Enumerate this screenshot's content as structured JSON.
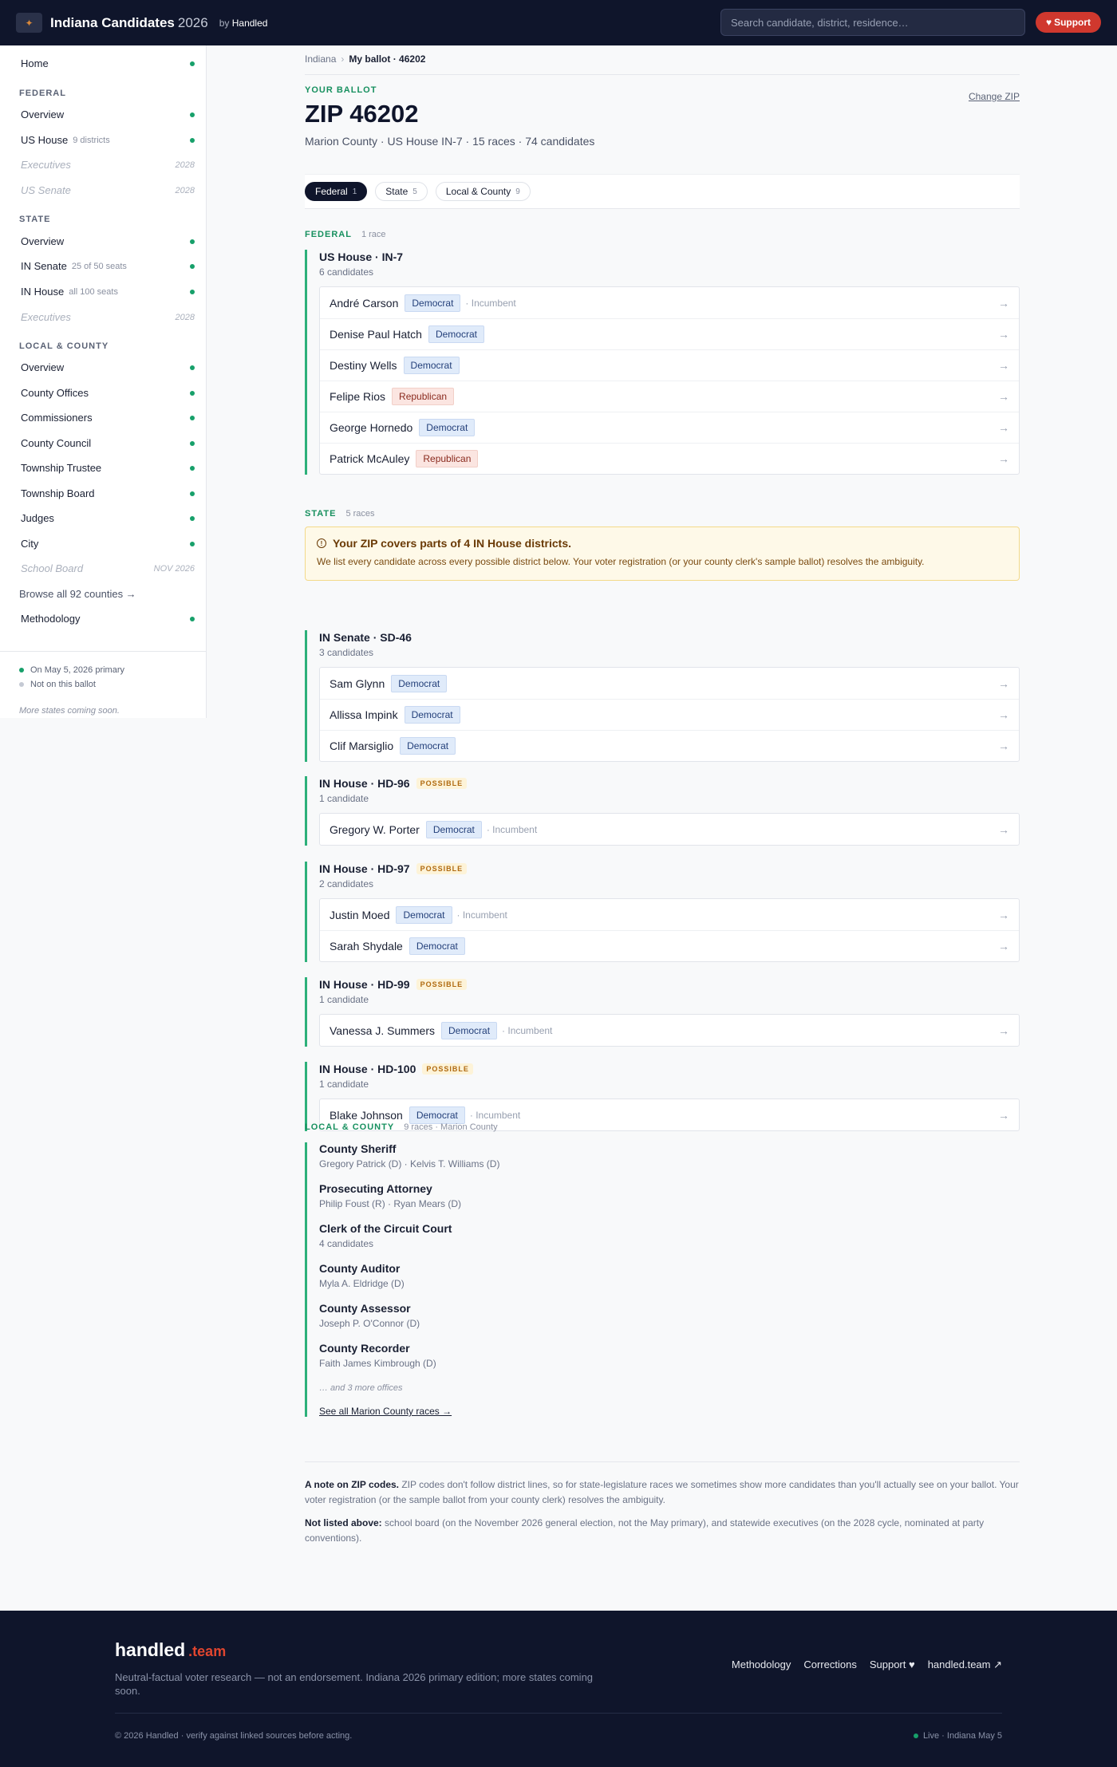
{
  "header": {
    "brand": "Indiana Candidates",
    "year": "2026",
    "by": "by",
    "by_name": "Handled",
    "search_placeholder": "Search candidate, district, residence…",
    "support_label": "Support",
    "support_icon": "heart-icon"
  },
  "sidebar": {
    "home": "Home",
    "federal_head": "FEDERAL",
    "federal": [
      {
        "label": "Overview",
        "sub": "",
        "active": true,
        "year": ""
      },
      {
        "label": "US House",
        "sub": "9 districts",
        "active": true,
        "year": ""
      },
      {
        "label": "Executives",
        "sub": "",
        "active": false,
        "year": "2028"
      },
      {
        "label": "US Senate",
        "sub": "",
        "active": false,
        "year": "2028"
      }
    ],
    "state_head": "STATE",
    "state": [
      {
        "label": "Overview",
        "sub": "",
        "active": true,
        "year": ""
      },
      {
        "label": "IN Senate",
        "sub": "25 of 50 seats",
        "active": true,
        "year": ""
      },
      {
        "label": "IN House",
        "sub": "all 100 seats",
        "active": true,
        "year": ""
      },
      {
        "label": "Executives",
        "sub": "",
        "active": false,
        "year": "2028"
      }
    ],
    "local_head": "LOCAL & COUNTY",
    "local": [
      {
        "label": "Overview",
        "active": true,
        "year": ""
      },
      {
        "label": "County Offices",
        "active": true,
        "year": ""
      },
      {
        "label": "Commissioners",
        "active": true,
        "year": ""
      },
      {
        "label": "County Council",
        "active": true,
        "year": ""
      },
      {
        "label": "Township Trustee",
        "active": true,
        "year": ""
      },
      {
        "label": "Township Board",
        "active": true,
        "year": ""
      },
      {
        "label": "Judges",
        "active": true,
        "year": ""
      },
      {
        "label": "City",
        "active": true,
        "year": ""
      },
      {
        "label": "School Board",
        "active": false,
        "year": "NOV 2026"
      }
    ],
    "browse": "Browse all 92 counties →",
    "methodology": "Methodology",
    "legend_on": "On May 5, 2026 primary",
    "legend_off": "Not on this ballot",
    "note": "More states coming soon.",
    "colors": {
      "active_dot": "#17a06a",
      "inactive_dot": "#c5cad4"
    }
  },
  "main": {
    "breadcrumb": [
      "Indiana",
      "My ballot · 46202"
    ],
    "eyebrow": "YOUR BALLOT",
    "title": "ZIP 46202",
    "change_zip": "Change ZIP",
    "subtitle": "Marion County · US House IN-7 · 15 races · 74 candidates",
    "tabs": [
      {
        "label": "Federal",
        "count": "1",
        "active": true
      },
      {
        "label": "State",
        "count": "5",
        "active": false
      },
      {
        "label": "Local & County",
        "count": "9",
        "active": false
      }
    ],
    "federal": {
      "name": "FEDERAL",
      "meta": "1 race",
      "race": {
        "title": "US House · IN-7",
        "count": "6 candidates",
        "candidates": [
          {
            "name": "André Carson",
            "party": "Democrat",
            "p": "dem",
            "inc": "· Incumbent"
          },
          {
            "name": "Denise Paul Hatch",
            "party": "Democrat",
            "p": "dem",
            "inc": ""
          },
          {
            "name": "Destiny Wells",
            "party": "Democrat",
            "p": "dem",
            "inc": ""
          },
          {
            "name": "Felipe Rios",
            "party": "Republican",
            "p": "rep",
            "inc": ""
          },
          {
            "name": "George Hornedo",
            "party": "Democrat",
            "p": "dem",
            "inc": ""
          },
          {
            "name": "Patrick McAuley",
            "party": "Republican",
            "p": "rep",
            "inc": ""
          }
        ]
      }
    },
    "state": {
      "name": "STATE",
      "meta": "5 races",
      "alert_title": "Your ZIP covers parts of 4 IN House districts.",
      "alert_body": "We list every candidate across every possible district below. Your voter registration (or your county clerk's sample ballot) resolves the ambiguity.",
      "races": [
        {
          "title": "IN Senate · SD-46",
          "count": "3 candidates",
          "possible": "",
          "candidates": [
            {
              "name": "Sam Glynn",
              "party": "Democrat",
              "p": "dem",
              "inc": ""
            },
            {
              "name": "Allissa Impink",
              "party": "Democrat",
              "p": "dem",
              "inc": ""
            },
            {
              "name": "Clif Marsiglio",
              "party": "Democrat",
              "p": "dem",
              "inc": ""
            }
          ]
        },
        {
          "title": "IN House · HD-96",
          "count": "1 candidate",
          "possible": "POSSIBLE",
          "candidates": [
            {
              "name": "Gregory W. Porter",
              "party": "Democrat",
              "p": "dem",
              "inc": "· Incumbent"
            }
          ]
        },
        {
          "title": "IN House · HD-97",
          "count": "2 candidates",
          "possible": "POSSIBLE",
          "candidates": [
            {
              "name": "Justin Moed",
              "party": "Democrat",
              "p": "dem",
              "inc": "· Incumbent"
            },
            {
              "name": "Sarah Shydale",
              "party": "Democrat",
              "p": "dem",
              "inc": ""
            }
          ]
        },
        {
          "title": "IN House · HD-99",
          "count": "1 candidate",
          "possible": "POSSIBLE",
          "candidates": [
            {
              "name": "Vanessa J. Summers",
              "party": "Democrat",
              "p": "dem",
              "inc": "· Incumbent"
            }
          ]
        },
        {
          "title": "IN House · HD-100",
          "count": "1 candidate",
          "possible": "POSSIBLE",
          "candidates": [
            {
              "name": "Blake Johnson",
              "party": "Democrat",
              "p": "dem",
              "inc": "· Incumbent"
            }
          ]
        }
      ]
    },
    "local": {
      "name": "LOCAL & COUNTY",
      "meta": "9 races · Marion County",
      "items": [
        {
          "title": "County Sheriff",
          "sub": "Gregory Patrick (D) · Kelvis T. Williams (D)"
        },
        {
          "title": "Prosecuting Attorney",
          "sub": "Philip Foust (R) · Ryan Mears (D)"
        },
        {
          "title": "Clerk of the Circuit Court",
          "sub": "4 candidates"
        },
        {
          "title": "County Auditor",
          "sub": "Myla A. Eldridge (D)"
        },
        {
          "title": "County Assessor",
          "sub": "Joseph P. O'Connor (D)"
        },
        {
          "title": "County Recorder",
          "sub": "Faith James Kimbrough (D)"
        }
      ],
      "more": "… and 3 more offices",
      "see_all": "See all Marion County races →"
    },
    "notes": {
      "zip_bold": "A note on ZIP codes.",
      "zip_text": " ZIP codes don't follow district lines, so for state-legislature races we sometimes show more candidates than you'll actually see on your ballot. Your voter registration (or the sample ballot from your county clerk) resolves the ambiguity.",
      "not_bold": "Not listed above:",
      "not_text": " school board (on the November 2026 general election, not the May primary), and statewide executives (on the 2028 cycle, nominated at party conventions)."
    }
  },
  "footer": {
    "brand": "handled",
    "tld": ".team",
    "tagline": "Neutral-factual voter research — not an endorsement. Indiana 2026 primary edition; more states coming soon.",
    "links": [
      "Methodology",
      "Corrections",
      "Support ♥",
      "handled.team ↗"
    ],
    "copyright": "© 2026 Handled · verify against linked sources before acting.",
    "live": "Live · Indiana May 5"
  }
}
